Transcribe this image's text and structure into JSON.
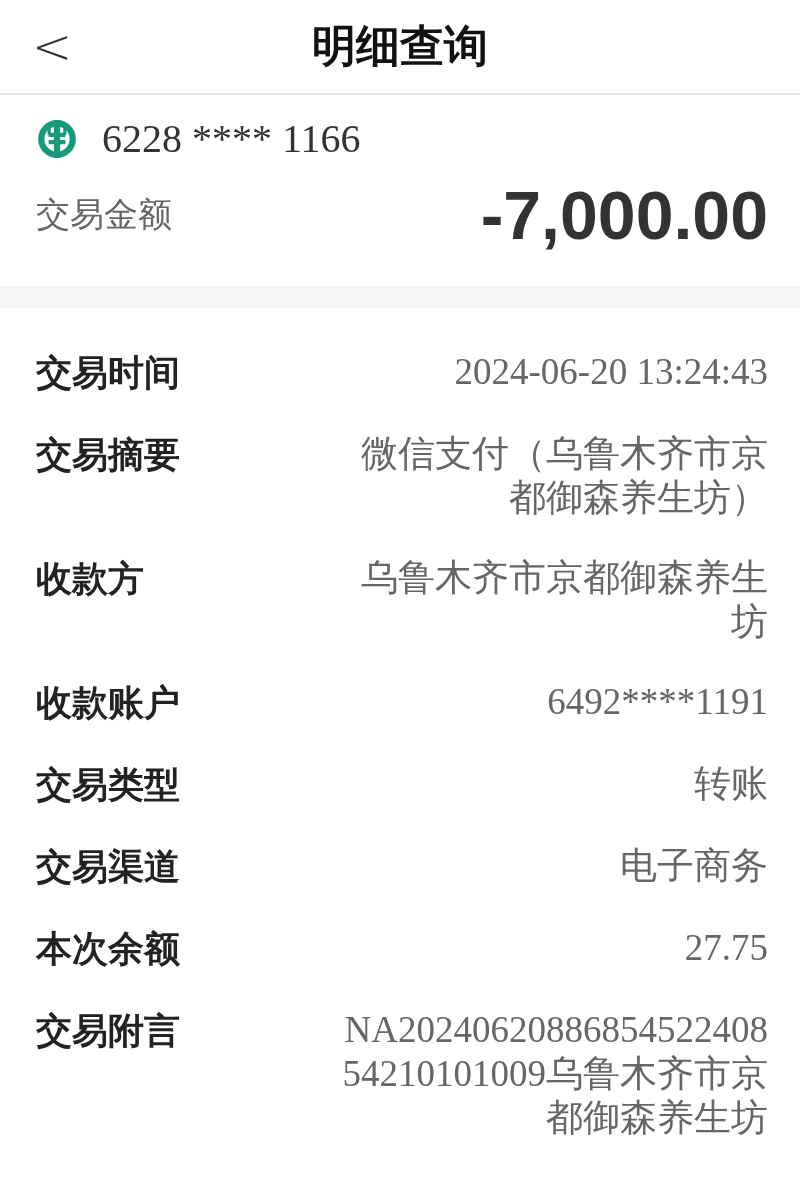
{
  "header": {
    "back": "<",
    "title": "明细查询"
  },
  "account": {
    "card_number": "6228 **** 1166",
    "amount_label": "交易金额",
    "amount": "-7,000.00"
  },
  "details": [
    {
      "label": "交易时间",
      "value": "2024-06-20 13:24:43"
    },
    {
      "label": "交易摘要",
      "value": "微信支付（乌鲁木齐市京都御森养生坊）"
    },
    {
      "label": "收款方",
      "value": "乌鲁木齐市京都御森养生坊"
    },
    {
      "label": "收款账户",
      "value": "6492****1191"
    },
    {
      "label": "交易类型",
      "value": "转账"
    },
    {
      "label": "交易渠道",
      "value": "电子商务"
    },
    {
      "label": "本次余额",
      "value": "27.75"
    },
    {
      "label": "交易附言",
      "value": "NA2024062088685452240854210101009乌鲁木齐市京都御森养生坊"
    }
  ]
}
